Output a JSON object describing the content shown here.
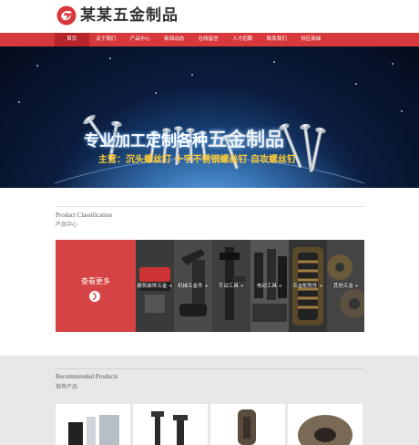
{
  "brand": {
    "name": "某某五金制品"
  },
  "nav": {
    "items": [
      {
        "label": "首页",
        "active": true
      },
      {
        "label": "关于我们",
        "active": false
      },
      {
        "label": "产品中心",
        "active": false
      },
      {
        "label": "新闻动态",
        "active": false
      },
      {
        "label": "在线留言",
        "active": false
      },
      {
        "label": "人才招聘",
        "active": false
      },
      {
        "label": "联系我们",
        "active": false
      },
      {
        "label": "供应商城",
        "active": false
      }
    ]
  },
  "banner": {
    "title_prefix": "专业加工定制各种",
    "title_emphasis": "五金制品",
    "subtitle": "主营：沉头螺丝钉 十字不锈钢螺丝钉 自攻螺丝钉"
  },
  "classification": {
    "title_en": "Product Classification",
    "title_cn": "产品中心",
    "more_label": "查看更多",
    "more_icon": "chevron-right-icon",
    "categories": [
      {
        "label": "建筑装饰五金 +"
      },
      {
        "label": "机械五金件 +"
      },
      {
        "label": "手动工具 +"
      },
      {
        "label": "电动工具 +"
      },
      {
        "label": "五金配附件 +"
      },
      {
        "label": "其他五金 +"
      }
    ]
  },
  "recommended": {
    "title_en": "Recommended Products",
    "title_cn": "推荐产品"
  },
  "colors": {
    "brand_red": "#d7383b",
    "nav_active": "#b52427",
    "banner_subtitle": "#ffcc33"
  }
}
